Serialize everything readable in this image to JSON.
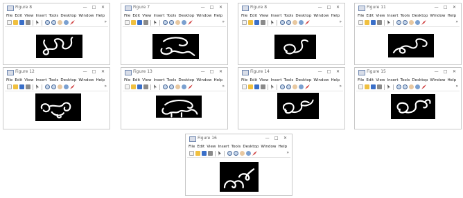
{
  "menus": [
    "File",
    "Edit",
    "View",
    "Insert",
    "Tools",
    "Desktop",
    "Window",
    "Help"
  ],
  "controls": {
    "minimize": "—",
    "maximize": "□",
    "close": "✕"
  },
  "overflow_glyph": "»",
  "windows": [
    {
      "title": "Figure 8",
      "glyph": "A"
    },
    {
      "title": "Figure 7",
      "glyph": "B"
    },
    {
      "title": "Figure 8",
      "glyph": "C"
    },
    {
      "title": "Figure 11",
      "glyph": "D"
    },
    {
      "title": "Figure 12",
      "glyph": "E"
    },
    {
      "title": "Figure 13",
      "glyph": "F"
    },
    {
      "title": "Figure 14",
      "glyph": "G"
    },
    {
      "title": "Figure 15",
      "glyph": "H"
    },
    {
      "title": "Figure 16",
      "glyph": "I"
    }
  ]
}
